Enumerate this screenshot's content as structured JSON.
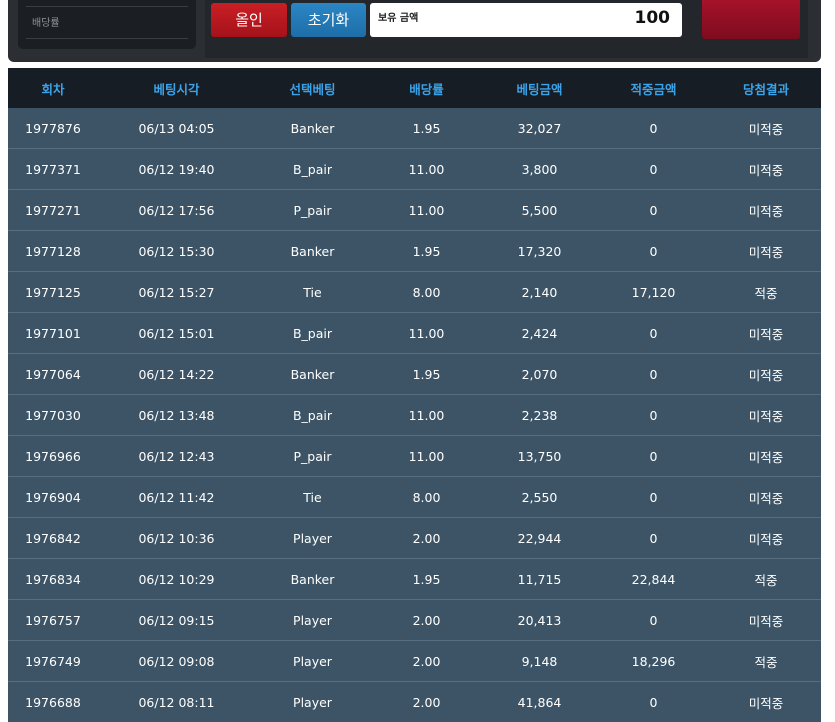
{
  "odds_panel": {
    "label": "배당률"
  },
  "controls": {
    "allin_label": "올인",
    "reset_label": "초기화",
    "balance_label": "보유 금액",
    "balance_value": "100"
  },
  "table": {
    "headers": [
      "회차",
      "베팅시각",
      "선택베팅",
      "배당률",
      "베팅금액",
      "적중금액",
      "당첨결과"
    ],
    "rows": [
      [
        "1977876",
        "06/13 04:05",
        "Banker",
        "1.95",
        "32,027",
        "0",
        "미적중"
      ],
      [
        "1977371",
        "06/12 19:40",
        "B_pair",
        "11.00",
        "3,800",
        "0",
        "미적중"
      ],
      [
        "1977271",
        "06/12 17:56",
        "P_pair",
        "11.00",
        "5,500",
        "0",
        "미적중"
      ],
      [
        "1977128",
        "06/12 15:30",
        "Banker",
        "1.95",
        "17,320",
        "0",
        "미적중"
      ],
      [
        "1977125",
        "06/12 15:27",
        "Tie",
        "8.00",
        "2,140",
        "17,120",
        "적중"
      ],
      [
        "1977101",
        "06/12 15:01",
        "B_pair",
        "11.00",
        "2,424",
        "0",
        "미적중"
      ],
      [
        "1977064",
        "06/12 14:22",
        "Banker",
        "1.95",
        "2,070",
        "0",
        "미적중"
      ],
      [
        "1977030",
        "06/12 13:48",
        "B_pair",
        "11.00",
        "2,238",
        "0",
        "미적중"
      ],
      [
        "1976966",
        "06/12 12:43",
        "P_pair",
        "11.00",
        "13,750",
        "0",
        "미적중"
      ],
      [
        "1976904",
        "06/12 11:42",
        "Tie",
        "8.00",
        "2,550",
        "0",
        "미적중"
      ],
      [
        "1976842",
        "06/12 10:36",
        "Player",
        "2.00",
        "22,944",
        "0",
        "미적중"
      ],
      [
        "1976834",
        "06/12 10:29",
        "Banker",
        "1.95",
        "11,715",
        "22,844",
        "적중"
      ],
      [
        "1976757",
        "06/12 09:15",
        "Player",
        "2.00",
        "20,413",
        "0",
        "미적중"
      ],
      [
        "1976749",
        "06/12 09:08",
        "Player",
        "2.00",
        "9,148",
        "18,296",
        "적중"
      ],
      [
        "1976688",
        "06/12 08:11",
        "Player",
        "2.00",
        "41,864",
        "0",
        "미적중"
      ]
    ]
  },
  "colors": {
    "header_text": "#3aa3ea",
    "row_bg": "#3c5466",
    "loss": "#d52a2a",
    "win": "#e7ad2a"
  }
}
